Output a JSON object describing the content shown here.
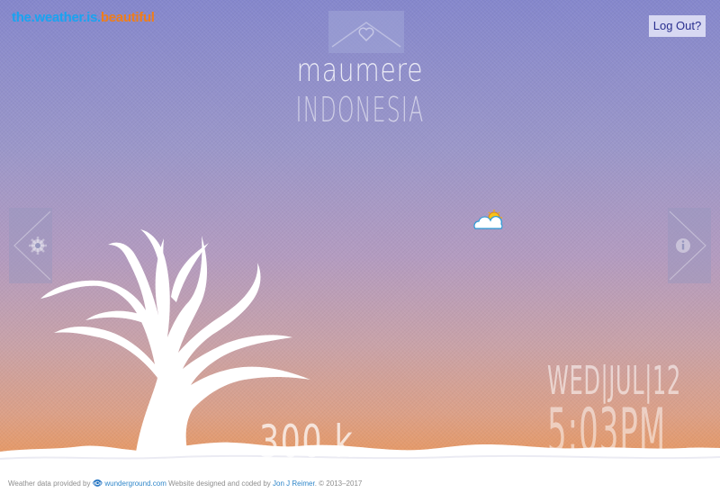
{
  "brand": {
    "part1": "the.weather.is.",
    "part2": "beautiful",
    "color1": "#1aa3f0",
    "color2": "#ef7d1a"
  },
  "header": {
    "logout_label": "Log Out?"
  },
  "location": {
    "city": "maumere",
    "country": "INDONESIA"
  },
  "weather": {
    "temperature": "300 k",
    "icon": "partly-cloudy-icon"
  },
  "datetime": {
    "date": "WED|JUL|12",
    "time": "5:03PM"
  },
  "nav": {
    "left_icon": "gear-icon",
    "right_icon": "info-icon",
    "home_icon": "heart-icon"
  },
  "footer": {
    "text1": "Weather data provided by",
    "provider": "wunderground.com",
    "text2": "Website designed and coded by",
    "author": "Jon J Reimer",
    "copyright": ". © 2013–2017"
  }
}
